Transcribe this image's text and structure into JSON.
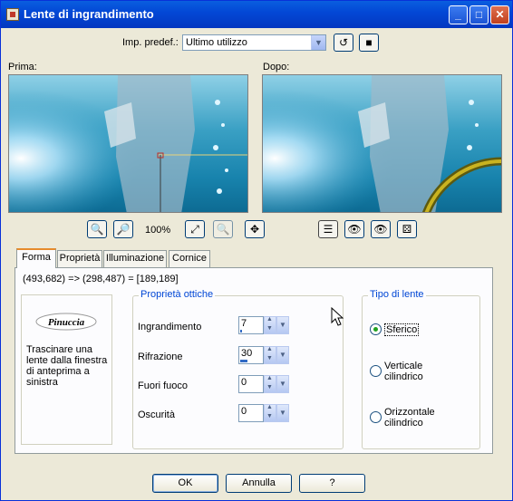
{
  "window": {
    "title": "Lente di ingrandimento",
    "controls": [
      "_",
      "□",
      "✕"
    ]
  },
  "presets": {
    "label": "Imp. predef.:",
    "selected": "Ultimo utilizzo"
  },
  "preview": {
    "before_label": "Prima:",
    "after_label": "Dopo:",
    "zoom": "100%"
  },
  "tabs": [
    "Forma",
    "Proprietà",
    "Illuminazione",
    "Cornice"
  ],
  "coords": "(493,682) => (298,487) = [189,189]",
  "shape_panel": {
    "logo": "Pinuccia",
    "help": "Trascinare una lente dalla finestra di anteprima a sinistra"
  },
  "optics": {
    "title": "Proprietà ottiche",
    "fields": [
      {
        "label": "Ingrandimento",
        "value": "7",
        "level": 0.07
      },
      {
        "label": "Rifrazione",
        "value": "30",
        "level": 0.3
      },
      {
        "label": "Fuori fuoco",
        "value": "0",
        "level": 0
      },
      {
        "label": "Oscurità",
        "value": "0",
        "level": 0
      }
    ]
  },
  "lens_type": {
    "title": "Tipo di lente",
    "options": [
      {
        "label": "Sferico",
        "selected": true
      },
      {
        "label": "Verticale cilindrico",
        "selected": false
      },
      {
        "label": "Orizzontale cilindrico",
        "selected": false
      }
    ]
  },
  "buttons": {
    "ok": "OK",
    "cancel": "Annulla",
    "help": "?"
  },
  "colors": {
    "title_bar": "#0348d6",
    "accent": "#316ac5",
    "group_title": "#0046d5"
  }
}
